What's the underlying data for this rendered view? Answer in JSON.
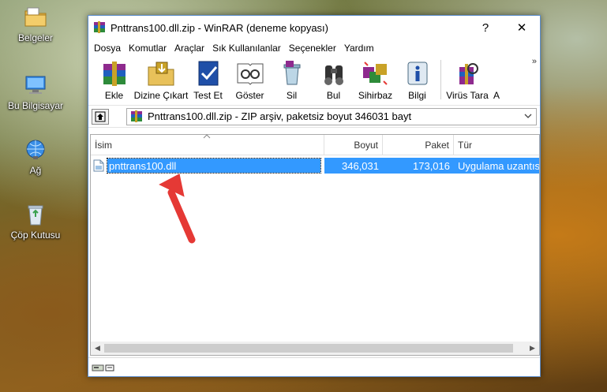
{
  "desktop": {
    "icons": [
      {
        "label": "Belgeler",
        "icon": "folder-icon"
      },
      {
        "label": "Bu Bilgisayar",
        "icon": "computer-icon"
      },
      {
        "label": "Ağ",
        "icon": "network-icon"
      },
      {
        "label": "Çöp Kutusu",
        "icon": "recycle-bin-icon"
      }
    ]
  },
  "window": {
    "title": "Pnttrans100.dll.zip - WinRAR (deneme kopyası)",
    "help_button": "?",
    "close_button": "✕"
  },
  "menu": [
    "Dosya",
    "Komutlar",
    "Araçlar",
    "Sık Kullanılanlar",
    "Seçenekler",
    "Yardım"
  ],
  "toolbar": {
    "buttons": [
      {
        "label": "Ekle",
        "icon": "add-archive-icon"
      },
      {
        "label": "Dizine Çıkart",
        "icon": "extract-icon"
      },
      {
        "label": "Test Et",
        "icon": "test-icon"
      },
      {
        "label": "Göster",
        "icon": "view-icon"
      },
      {
        "label": "Sil",
        "icon": "delete-icon"
      },
      {
        "label": "Bul",
        "icon": "find-icon"
      },
      {
        "label": "Sihirbaz",
        "icon": "wizard-icon"
      },
      {
        "label": "Bilgi",
        "icon": "info-icon"
      },
      {
        "label": "Virüs Tara",
        "icon": "virus-scan-icon"
      },
      {
        "label": "A",
        "icon": "more-icon"
      }
    ],
    "overflow": "»"
  },
  "address": {
    "path": "Pnttrans100.dll.zip - ZIP arşiv, paketsiz boyut 346031 bayt"
  },
  "filelist": {
    "columns": [
      "İsim",
      "Boyut",
      "Paket",
      "Tür"
    ],
    "rows": [
      {
        "name": "pnttrans100.dll",
        "size": "346,031",
        "packed": "173,016",
        "type": "Uygulama uzantısı"
      }
    ]
  },
  "colors": {
    "selection": "#3399ff",
    "annotation_arrow": "#e53935"
  }
}
